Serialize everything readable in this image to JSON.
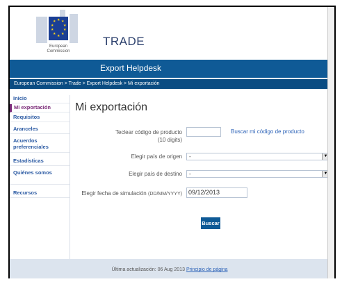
{
  "header": {
    "logo_caption_line1": "European",
    "logo_caption_line2": "Commission",
    "title": "TRADE",
    "subtitle": "Export Helpdesk"
  },
  "breadcrumb": "European Commission > Trade > Export Helpdesk > Mi exportación",
  "nav": {
    "items": [
      {
        "label": "Inicio"
      },
      {
        "label": "Mi exportación"
      },
      {
        "label": "Requisitos"
      },
      {
        "label": "Aranceles"
      },
      {
        "label": "Acuerdos preferenciales"
      },
      {
        "label": "Estadísticas"
      },
      {
        "label": "Quiénes somos"
      },
      {
        "label": "Recursos"
      }
    ]
  },
  "main": {
    "title": "Mi exportación",
    "product_code_label": "Teclear código de producto",
    "product_code_hint": "(10 digits)",
    "product_code_value": "",
    "find_code_link": "Buscar mi código de producto",
    "origin_label": "Elegir país de origen",
    "origin_value": "-",
    "destination_label": "Elegir país de destino",
    "destination_value": "-",
    "sim_date_label": "Elegir fecha de simulación",
    "sim_date_format": "(DD/MM/YYYY)",
    "sim_date_value": "09/12/2013",
    "search_button": "Buscar"
  },
  "footer": {
    "updated_text": "Última actualización: 06 Aug 2013",
    "top_link": "Principio de página"
  },
  "colors": {
    "brand_blue": "#0f5a96",
    "breadcrumb_blue": "#0a4c82",
    "active_nav": "#7a2a78",
    "link": "#2d63b8"
  }
}
